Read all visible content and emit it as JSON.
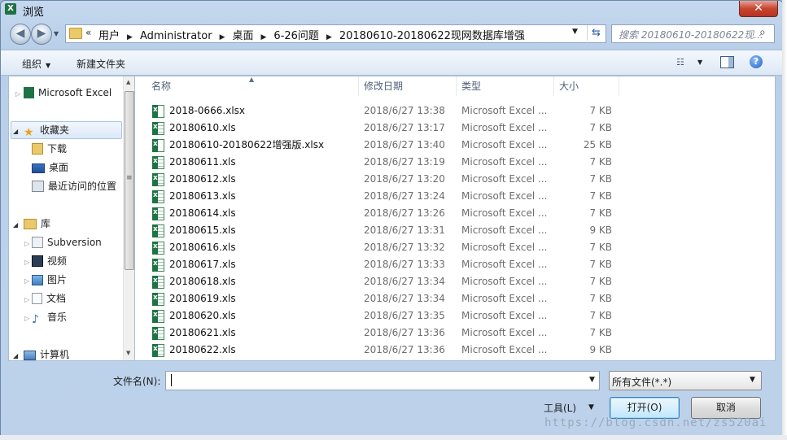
{
  "window": {
    "title": "浏览",
    "app_icon": "X",
    "close": "✕"
  },
  "nav": {
    "back": "◀",
    "forward": "▶",
    "chevrons": "«",
    "breadcrumb": [
      "用户",
      "Administrator",
      "桌面",
      "6-26问题",
      "20180610-20180622现网数据库增强"
    ],
    "search_placeholder": "搜索 20180610-20180622现..."
  },
  "toolbar": {
    "organize": "组织",
    "new_folder": "新建文件夹"
  },
  "navpane": {
    "items": [
      {
        "label": "Microsoft Excel"
      },
      {
        "label": "收藏夹"
      },
      {
        "label": "下载"
      },
      {
        "label": "桌面"
      },
      {
        "label": "最近访问的位置"
      },
      {
        "label": "库"
      },
      {
        "label": "Subversion"
      },
      {
        "label": "视频"
      },
      {
        "label": "图片"
      },
      {
        "label": "文档"
      },
      {
        "label": "音乐"
      },
      {
        "label": "计算机"
      }
    ]
  },
  "columns": {
    "name": "名称",
    "date": "修改日期",
    "type": "类型",
    "size": "大小"
  },
  "files": [
    {
      "name": "2018-0666.xlsx",
      "date": "2018/6/27 13:38",
      "type": "Microsoft Excel ...",
      "size": "7 KB"
    },
    {
      "name": "20180610.xls",
      "date": "2018/6/27 13:17",
      "type": "Microsoft Excel ...",
      "size": "7 KB"
    },
    {
      "name": "20180610-20180622增强版.xlsx",
      "date": "2018/6/27 13:40",
      "type": "Microsoft Excel ...",
      "size": "25 KB"
    },
    {
      "name": "20180611.xls",
      "date": "2018/6/27 13:19",
      "type": "Microsoft Excel ...",
      "size": "7 KB"
    },
    {
      "name": "20180612.xls",
      "date": "2018/6/27 13:20",
      "type": "Microsoft Excel ...",
      "size": "7 KB"
    },
    {
      "name": "20180613.xls",
      "date": "2018/6/27 13:24",
      "type": "Microsoft Excel ...",
      "size": "7 KB"
    },
    {
      "name": "20180614.xls",
      "date": "2018/6/27 13:26",
      "type": "Microsoft Excel ...",
      "size": "7 KB"
    },
    {
      "name": "20180615.xls",
      "date": "2018/6/27 13:31",
      "type": "Microsoft Excel ...",
      "size": "9 KB"
    },
    {
      "name": "20180616.xls",
      "date": "2018/6/27 13:32",
      "type": "Microsoft Excel ...",
      "size": "7 KB"
    },
    {
      "name": "20180617.xls",
      "date": "2018/6/27 13:33",
      "type": "Microsoft Excel ...",
      "size": "7 KB"
    },
    {
      "name": "20180618.xls",
      "date": "2018/6/27 13:34",
      "type": "Microsoft Excel ...",
      "size": "7 KB"
    },
    {
      "name": "20180619.xls",
      "date": "2018/6/27 13:34",
      "type": "Microsoft Excel ...",
      "size": "7 KB"
    },
    {
      "name": "20180620.xls",
      "date": "2018/6/27 13:35",
      "type": "Microsoft Excel ...",
      "size": "7 KB"
    },
    {
      "name": "20180621.xls",
      "date": "2018/6/27 13:36",
      "type": "Microsoft Excel ...",
      "size": "7 KB"
    },
    {
      "name": "20180622.xls",
      "date": "2018/6/27 13:36",
      "type": "Microsoft Excel ...",
      "size": "9 KB"
    }
  ],
  "bottom": {
    "filename_label": "文件名(N):",
    "filename_value": "",
    "filter": "所有文件(*.*)",
    "tools": "工具(L)",
    "open": "打开(O)",
    "cancel": "取消"
  },
  "watermark": "https://blog.csdn.net/zs520ai"
}
